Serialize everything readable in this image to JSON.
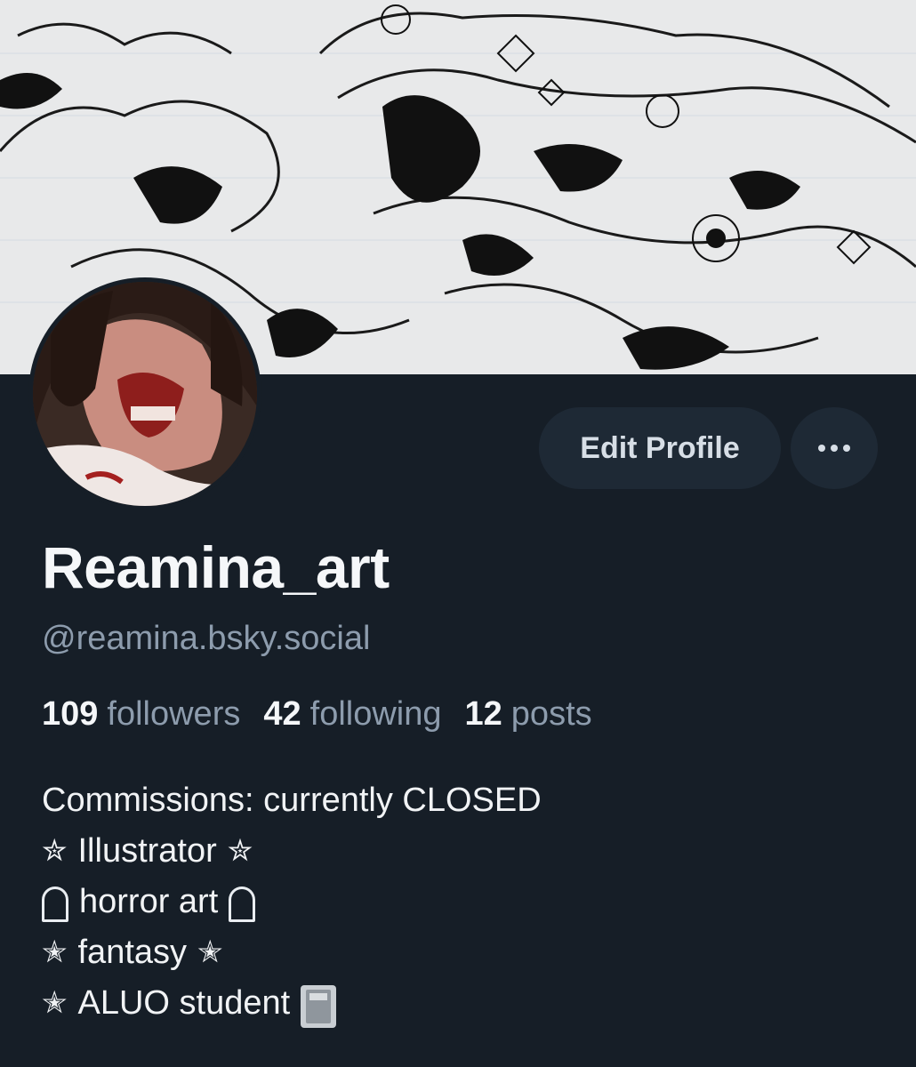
{
  "profile": {
    "display_name": "Reamina_art",
    "handle": "@reamina.bsky.social",
    "banner_image": "ink-drawing-banner",
    "avatar_image": "horror-portrait-avatar"
  },
  "actions": {
    "edit_label": "Edit Profile",
    "more_icon": "ellipsis-icon"
  },
  "stats": {
    "followers_count": "109",
    "followers_label": "followers",
    "following_count": "42",
    "following_label": "following",
    "posts_count": "12",
    "posts_label": "posts"
  },
  "bio": {
    "line1": "Commissions: currently CLOSED",
    "line2": "Illustrator",
    "line3": "horror art",
    "line4": "fantasy",
    "line5": "ALUO student",
    "star_outline": "✮",
    "star_filled": "✭"
  },
  "colors": {
    "background": "#161e27",
    "button_bg": "#1e2935",
    "muted_text": "#8d9cad",
    "primary_text": "#f5f7f9"
  }
}
